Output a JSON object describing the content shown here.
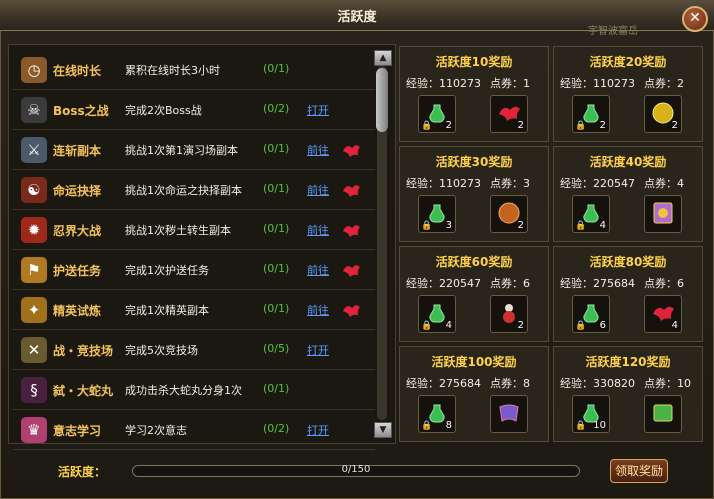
{
  "window": {
    "title": "活跃度",
    "subtitle": "宇智波富岳",
    "close_glyph": "✕"
  },
  "tasks": [
    {
      "icon": "clock-icon",
      "name": "在线时长",
      "desc": "累积在线时长3小时",
      "progress": "(0/1)",
      "link": "",
      "reward": false
    },
    {
      "icon": "boss-icon",
      "name": "Boss之战",
      "desc": "完成2次Boss战",
      "progress": "(0/2)",
      "link": "打开",
      "reward": false
    },
    {
      "icon": "sword-icon",
      "name": "连斩副本",
      "desc": "挑战1次第1演习场副本",
      "progress": "(0/1)",
      "link": "前往",
      "reward": true
    },
    {
      "icon": "fate-icon",
      "name": "命运抉择",
      "desc": "挑战1次命运之抉择副本",
      "progress": "(0/1)",
      "link": "前往",
      "reward": true
    },
    {
      "icon": "fire-icon",
      "name": "忍界大战",
      "desc": "挑战1次秽土转生副本",
      "progress": "(0/1)",
      "link": "前往",
      "reward": true
    },
    {
      "icon": "escort-icon",
      "name": "护送任务",
      "desc": "完成1次护送任务",
      "progress": "(0/1)",
      "link": "前往",
      "reward": true
    },
    {
      "icon": "elite-icon",
      "name": "精英试炼",
      "desc": "完成1次精英副本",
      "progress": "(0/1)",
      "link": "前往",
      "reward": true
    },
    {
      "icon": "arena-icon",
      "name": "战・竞技场",
      "desc": "完成5次竞技场",
      "progress": "(0/5)",
      "link": "打开",
      "reward": false
    },
    {
      "icon": "snake-icon",
      "name": "弑・大蛇丸",
      "desc": "成功击杀大蛇丸分身1次",
      "progress": "(0/1)",
      "link": "",
      "reward": false
    },
    {
      "icon": "will-icon",
      "name": "意志学习",
      "desc": "学习2次意志",
      "progress": "(0/2)",
      "link": "打开",
      "reward": false
    }
  ],
  "rewards": [
    {
      "title": "活跃度10奖励",
      "exp": "经验：110273",
      "coupon": "点券：1",
      "items": [
        {
          "icon": "potion-icon",
          "count": "2"
        },
        {
          "icon": "red-bird-icon",
          "count": "2"
        }
      ]
    },
    {
      "title": "活跃度20奖励",
      "exp": "经验：110273",
      "coupon": "点券：2",
      "items": [
        {
          "icon": "potion-icon",
          "count": "2"
        },
        {
          "icon": "gold-orb-icon",
          "count": "2"
        }
      ]
    },
    {
      "title": "活跃度30奖励",
      "exp": "经验：110273",
      "coupon": "点券：3",
      "items": [
        {
          "icon": "potion-icon",
          "count": "3"
        },
        {
          "icon": "amber-orb-icon",
          "count": "2"
        }
      ]
    },
    {
      "title": "活跃度40奖励",
      "exp": "经验：220547",
      "coupon": "点券：4",
      "items": [
        {
          "icon": "potion-icon",
          "count": "4"
        },
        {
          "icon": "scroll-card-icon",
          "count": ""
        }
      ]
    },
    {
      "title": "活跃度60奖励",
      "exp": "经验：220547",
      "coupon": "点券：6",
      "items": [
        {
          "icon": "potion-icon",
          "count": "4"
        },
        {
          "icon": "gourd-icon",
          "count": "2"
        }
      ]
    },
    {
      "title": "活跃度80奖励",
      "exp": "经验：275684",
      "coupon": "点券：6",
      "items": [
        {
          "icon": "potion-icon",
          "count": "6"
        },
        {
          "icon": "red-bird-icon",
          "count": "4"
        }
      ]
    },
    {
      "title": "活跃度100奖励",
      "exp": "经验：275684",
      "coupon": "点券：8",
      "items": [
        {
          "icon": "potion-icon",
          "count": "8"
        },
        {
          "icon": "cloth-icon",
          "count": ""
        }
      ]
    },
    {
      "title": "活跃度120奖励",
      "exp": "经验：330820",
      "coupon": "点券：10",
      "items": [
        {
          "icon": "potion-icon",
          "count": "10"
        },
        {
          "icon": "green-book-icon",
          "count": ""
        }
      ]
    }
  ],
  "footer": {
    "label": "活跃度：",
    "progress_text": "0/150",
    "progress_fraction": 0,
    "claim_label": "领取奖励"
  },
  "scrollbar": {
    "up": "▲",
    "down": "▼"
  },
  "lock_glyph": "🔒"
}
